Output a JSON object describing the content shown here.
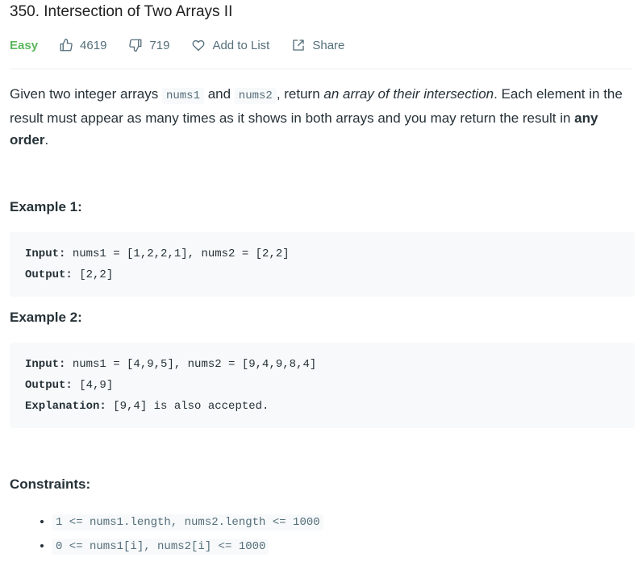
{
  "problem": {
    "title": "350. Intersection of Two Arrays II",
    "difficulty": "Easy",
    "likes": "4619",
    "dislikes": "719",
    "add_to_list": "Add to List",
    "share": "Share"
  },
  "description": {
    "p1": "Given two integer arrays ",
    "code1": "nums1",
    "p2": " and ",
    "code2": "nums2",
    "p3": ", return ",
    "em": "an array of their intersection",
    "p4": ". Each element in the result must appear as many times as it shows in both arrays and you may return the result in ",
    "strong": "any order",
    "p5": "."
  },
  "examples": [
    {
      "heading": "Example 1:",
      "input_label": "Input:",
      "input_value": " nums1 = [1,2,2,1], nums2 = [2,2]",
      "output_label": "Output:",
      "output_value": " [2,2]"
    },
    {
      "heading": "Example 2:",
      "input_label": "Input:",
      "input_value": " nums1 = [4,9,5], nums2 = [9,4,9,8,4]",
      "output_label": "Output:",
      "output_value": " [4,9]",
      "explanation_label": "Explanation:",
      "explanation_value": " [9,4] is also accepted."
    }
  ],
  "constraints": {
    "heading": "Constraints:",
    "items": [
      "1 <= nums1.length, nums2.length <= 1000",
      "0 <= nums1[i], nums2[i] <= 1000"
    ]
  },
  "colors": {
    "easy": "#5cb85c",
    "text": "#263238",
    "muted": "#546e7a",
    "code_bg": "#f7f9fa"
  },
  "icons": [
    "thumbs-up-icon",
    "thumbs-down-icon",
    "heart-icon",
    "share-icon"
  ]
}
